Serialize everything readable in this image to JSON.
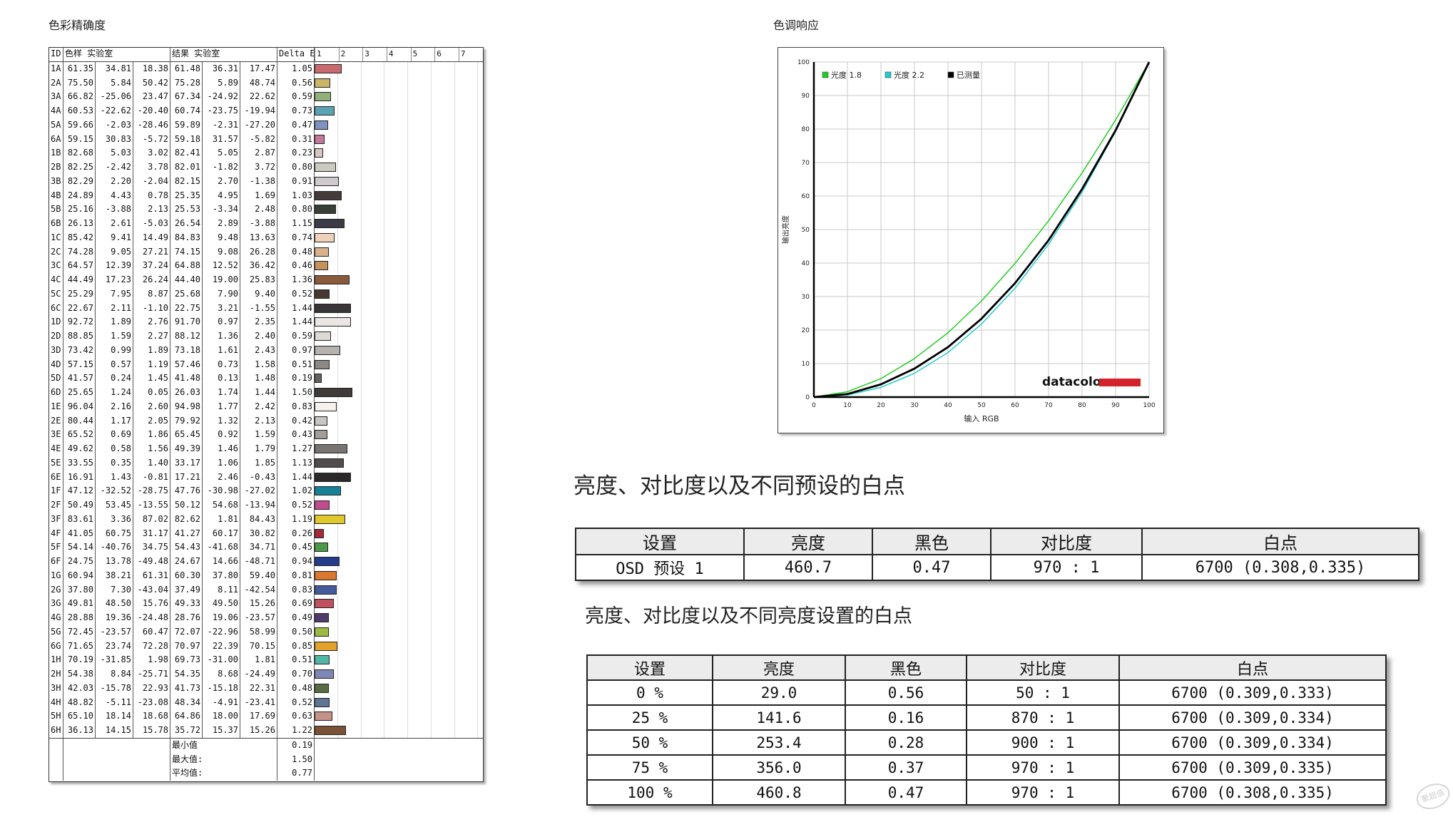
{
  "headings": {
    "color_accuracy": "色彩精确度",
    "tone_response": "色调响应"
  },
  "color_accuracy": {
    "columns": {
      "id": "ID",
      "sample": "色样 实验室",
      "result": "结果 实验室",
      "delta": "Delta E",
      "ruler": [
        "1",
        "2",
        "3",
        "4",
        "5",
        "6",
        "7"
      ]
    },
    "rows": [
      {
        "id": "1A",
        "sample": [
          "61.35",
          "34.81",
          "18.38"
        ],
        "result": [
          "61.48",
          "36.31",
          "17.47"
        ],
        "delta": "1.05",
        "de": 1.05,
        "color": "#c96a6f"
      },
      {
        "id": "2A",
        "sample": [
          "75.50",
          "5.84",
          "50.42"
        ],
        "result": [
          "75.28",
          "5.89",
          "48.74"
        ],
        "delta": "0.56",
        "de": 0.56,
        "color": "#cdb568"
      },
      {
        "id": "3A",
        "sample": [
          "66.82",
          "-25.06",
          "23.47"
        ],
        "result": [
          "67.34",
          "-24.92",
          "22.62"
        ],
        "delta": "0.59",
        "de": 0.59,
        "color": "#90b07a"
      },
      {
        "id": "4A",
        "sample": [
          "60.53",
          "-22.62",
          "-20.40"
        ],
        "result": [
          "60.74",
          "-23.75",
          "-19.94"
        ],
        "delta": "0.73",
        "de": 0.73,
        "color": "#5aa3b3"
      },
      {
        "id": "5A",
        "sample": [
          "59.66",
          "-2.03",
          "-28.46"
        ],
        "result": [
          "59.89",
          "-2.31",
          "-27.20"
        ],
        "delta": "0.47",
        "de": 0.47,
        "color": "#7f92c1"
      },
      {
        "id": "6A",
        "sample": [
          "59.15",
          "30.83",
          "-5.72"
        ],
        "result": [
          "59.18",
          "31.57",
          "-5.82"
        ],
        "delta": "0.31",
        "de": 0.31,
        "color": "#c4799b"
      },
      {
        "id": "1B",
        "sample": [
          "82.68",
          "5.03",
          "3.02"
        ],
        "result": [
          "82.41",
          "5.05",
          "2.87"
        ],
        "delta": "0.23",
        "de": 0.23,
        "color": "#d9c6c2"
      },
      {
        "id": "2B",
        "sample": [
          "82.25",
          "-2.42",
          "3.78"
        ],
        "result": [
          "82.01",
          "-1.82",
          "3.72"
        ],
        "delta": "0.80",
        "de": 0.8,
        "color": "#cccbc1"
      },
      {
        "id": "3B",
        "sample": [
          "82.29",
          "2.20",
          "-2.04"
        ],
        "result": [
          "82.15",
          "2.70",
          "-1.38"
        ],
        "delta": "0.91",
        "de": 0.91,
        "color": "#d0cacf"
      },
      {
        "id": "4B",
        "sample": [
          "24.89",
          "4.43",
          "0.78"
        ],
        "result": [
          "25.35",
          "4.95",
          "1.69"
        ],
        "delta": "1.03",
        "de": 1.03,
        "color": "#443c3b"
      },
      {
        "id": "5B",
        "sample": [
          "25.16",
          "-3.88",
          "2.13"
        ],
        "result": [
          "25.53",
          "-3.34",
          "2.48"
        ],
        "delta": "0.80",
        "de": 0.8,
        "color": "#383f37"
      },
      {
        "id": "6B",
        "sample": [
          "26.13",
          "2.61",
          "-5.03"
        ],
        "result": [
          "26.54",
          "2.89",
          "-3.88"
        ],
        "delta": "1.15",
        "de": 1.15,
        "color": "#3c3c46"
      },
      {
        "id": "1C",
        "sample": [
          "85.42",
          "9.41",
          "14.49"
        ],
        "result": [
          "84.83",
          "9.48",
          "13.63"
        ],
        "delta": "0.74",
        "de": 0.74,
        "color": "#efd1bc"
      },
      {
        "id": "2C",
        "sample": [
          "74.28",
          "9.05",
          "27.21"
        ],
        "result": [
          "74.15",
          "9.08",
          "26.28"
        ],
        "delta": "0.48",
        "de": 0.48,
        "color": "#d9b28c"
      },
      {
        "id": "3C",
        "sample": [
          "64.57",
          "12.39",
          "37.24"
        ],
        "result": [
          "64.88",
          "12.52",
          "36.42"
        ],
        "delta": "0.46",
        "de": 0.46,
        "color": "#c3935b"
      },
      {
        "id": "4C",
        "sample": [
          "44.49",
          "17.23",
          "26.24"
        ],
        "result": [
          "44.40",
          "19.00",
          "25.83"
        ],
        "delta": "1.36",
        "de": 1.36,
        "color": "#8a5a3c"
      },
      {
        "id": "5C",
        "sample": [
          "25.29",
          "7.95",
          "8.87"
        ],
        "result": [
          "25.68",
          "7.90",
          "9.40"
        ],
        "delta": "0.52",
        "de": 0.52,
        "color": "#4a3730"
      },
      {
        "id": "6C",
        "sample": [
          "22.67",
          "2.11",
          "-1.10"
        ],
        "result": [
          "22.75",
          "3.21",
          "-1.55"
        ],
        "delta": "1.44",
        "de": 1.44,
        "color": "#383536"
      },
      {
        "id": "1D",
        "sample": [
          "92.72",
          "1.89",
          "2.76"
        ],
        "result": [
          "91.70",
          "0.97",
          "2.35"
        ],
        "delta": "1.44",
        "de": 1.44,
        "color": "#ebe6e3"
      },
      {
        "id": "2D",
        "sample": [
          "88.85",
          "1.59",
          "2.27"
        ],
        "result": [
          "88.12",
          "1.36",
          "2.40"
        ],
        "delta": "0.59",
        "de": 0.59,
        "color": "#ddd9d5"
      },
      {
        "id": "3D",
        "sample": [
          "73.42",
          "0.99",
          "1.89"
        ],
        "result": [
          "73.18",
          "1.61",
          "2.43"
        ],
        "delta": "0.97",
        "de": 0.97,
        "color": "#b7b2ae"
      },
      {
        "id": "4D",
        "sample": [
          "57.15",
          "0.57",
          "1.19"
        ],
        "result": [
          "57.46",
          "0.73",
          "1.58"
        ],
        "delta": "0.51",
        "de": 0.51,
        "color": "#8c8885"
      },
      {
        "id": "5D",
        "sample": [
          "41.57",
          "0.24",
          "1.45"
        ],
        "result": [
          "41.48",
          "0.13",
          "1.48"
        ],
        "delta": "0.19",
        "de": 0.19,
        "color": "#64615e"
      },
      {
        "id": "6D",
        "sample": [
          "25.65",
          "1.24",
          "0.05"
        ],
        "result": [
          "26.03",
          "1.74",
          "1.44"
        ],
        "delta": "1.50",
        "de": 1.5,
        "color": "#3e3b3a"
      },
      {
        "id": "1E",
        "sample": [
          "96.04",
          "2.16",
          "2.60"
        ],
        "result": [
          "94.98",
          "1.77",
          "2.42"
        ],
        "delta": "0.83",
        "de": 0.83,
        "color": "#f6f1ee"
      },
      {
        "id": "2E",
        "sample": [
          "80.44",
          "1.17",
          "2.05"
        ],
        "result": [
          "79.92",
          "1.32",
          "2.13"
        ],
        "delta": "0.42",
        "de": 0.42,
        "color": "#c9c5c1"
      },
      {
        "id": "3E",
        "sample": [
          "65.52",
          "0.69",
          "1.86"
        ],
        "result": [
          "65.45",
          "0.92",
          "1.59"
        ],
        "delta": "0.43",
        "de": 0.43,
        "color": "#a19d99"
      },
      {
        "id": "4E",
        "sample": [
          "49.62",
          "0.58",
          "1.56"
        ],
        "result": [
          "49.39",
          "1.46",
          "1.79"
        ],
        "delta": "1.27",
        "de": 1.27,
        "color": "#777472"
      },
      {
        "id": "5E",
        "sample": [
          "33.55",
          "0.35",
          "1.40"
        ],
        "result": [
          "33.17",
          "1.06",
          "1.85"
        ],
        "delta": "1.13",
        "de": 1.13,
        "color": "#504d4c"
      },
      {
        "id": "6E",
        "sample": [
          "16.91",
          "1.43",
          "-0.81"
        ],
        "result": [
          "17.21",
          "2.46",
          "-0.43"
        ],
        "delta": "1.44",
        "de": 1.44,
        "color": "#2a2829"
      },
      {
        "id": "1F",
        "sample": [
          "47.12",
          "-32.52",
          "-28.75"
        ],
        "result": [
          "47.76",
          "-30.98",
          "-27.02"
        ],
        "delta": "1.02",
        "de": 1.02,
        "color": "#168298"
      },
      {
        "id": "2F",
        "sample": [
          "50.49",
          "53.45",
          "-13.55"
        ],
        "result": [
          "50.12",
          "54.68",
          "-13.94"
        ],
        "delta": "0.52",
        "de": 0.52,
        "color": "#c24b8e"
      },
      {
        "id": "3F",
        "sample": [
          "83.61",
          "3.36",
          "87.02"
        ],
        "result": [
          "82.62",
          "1.81",
          "84.43"
        ],
        "delta": "1.19",
        "de": 1.19,
        "color": "#e1c92b"
      },
      {
        "id": "4F",
        "sample": [
          "41.05",
          "60.75",
          "31.17"
        ],
        "result": [
          "41.27",
          "60.17",
          "30.82"
        ],
        "delta": "0.26",
        "de": 0.26,
        "color": "#a5283c"
      },
      {
        "id": "5F",
        "sample": [
          "54.14",
          "-40.76",
          "34.75"
        ],
        "result": [
          "54.43",
          "-41.68",
          "34.71"
        ],
        "delta": "0.45",
        "de": 0.45,
        "color": "#4c9a48"
      },
      {
        "id": "6F",
        "sample": [
          "24.75",
          "13.78",
          "-49.48"
        ],
        "result": [
          "24.67",
          "14.66",
          "-48.71"
        ],
        "delta": "0.94",
        "de": 0.94,
        "color": "#243c8a"
      },
      {
        "id": "1G",
        "sample": [
          "60.94",
          "38.21",
          "61.31"
        ],
        "result": [
          "60.30",
          "37.80",
          "59.40"
        ],
        "delta": "0.81",
        "de": 0.81,
        "color": "#d9782e"
      },
      {
        "id": "2G",
        "sample": [
          "37.80",
          "7.30",
          "-43.04"
        ],
        "result": [
          "37.49",
          "8.11",
          "-42.54"
        ],
        "delta": "0.83",
        "de": 0.83,
        "color": "#435a9c"
      },
      {
        "id": "3G",
        "sample": [
          "49.81",
          "48.50",
          "15.76"
        ],
        "result": [
          "49.33",
          "49.50",
          "15.26"
        ],
        "delta": "0.69",
        "de": 0.69,
        "color": "#c25160"
      },
      {
        "id": "4G",
        "sample": [
          "28.88",
          "19.36",
          "-24.48"
        ],
        "result": [
          "28.76",
          "19.06",
          "-23.57"
        ],
        "delta": "0.49",
        "de": 0.49,
        "color": "#503c6a"
      },
      {
        "id": "5G",
        "sample": [
          "72.45",
          "-23.57",
          "60.47"
        ],
        "result": [
          "72.07",
          "-22.96",
          "58.99"
        ],
        "delta": "0.50",
        "de": 0.5,
        "color": "#9cba43"
      },
      {
        "id": "6G",
        "sample": [
          "71.65",
          "23.74",
          "72.28"
        ],
        "result": [
          "70.97",
          "22.39",
          "70.15"
        ],
        "delta": "0.85",
        "de": 0.85,
        "color": "#e2a22c"
      },
      {
        "id": "1H",
        "sample": [
          "70.19",
          "-31.85",
          "1.98"
        ],
        "result": [
          "69.73",
          "-31.00",
          "1.81"
        ],
        "delta": "0.51",
        "de": 0.51,
        "color": "#50b7a4"
      },
      {
        "id": "2H",
        "sample": [
          "54.38",
          "8.84",
          "-25.71"
        ],
        "result": [
          "54.35",
          "8.68",
          "-24.49"
        ],
        "delta": "0.70",
        "de": 0.7,
        "color": "#7f87b7"
      },
      {
        "id": "3H",
        "sample": [
          "42.03",
          "-15.78",
          "22.93"
        ],
        "result": [
          "41.73",
          "-15.18",
          "22.31"
        ],
        "delta": "0.48",
        "de": 0.48,
        "color": "#596c43"
      },
      {
        "id": "4H",
        "sample": [
          "48.82",
          "-5.11",
          "-23.08"
        ],
        "result": [
          "48.34",
          "-4.91",
          "-23.41"
        ],
        "delta": "0.52",
        "de": 0.52,
        "color": "#5e7596"
      },
      {
        "id": "5H",
        "sample": [
          "65.10",
          "18.14",
          "18.68"
        ],
        "result": [
          "64.86",
          "18.00",
          "17.69"
        ],
        "delta": "0.63",
        "de": 0.63,
        "color": "#c49286"
      },
      {
        "id": "6H",
        "sample": [
          "36.13",
          "14.15",
          "15.78"
        ],
        "result": [
          "35.72",
          "15.37",
          "15.26"
        ],
        "delta": "1.22",
        "de": 1.22,
        "color": "#7a5238"
      }
    ],
    "summary": [
      {
        "label": "最小值",
        "value": "0.19"
      },
      {
        "label": "最大值:",
        "value": "1.50"
      },
      {
        "label": "平均值:",
        "value": "0.77"
      }
    ]
  },
  "chart_data": {
    "type": "line",
    "title": "色调响应",
    "xlabel": "输入 RGB",
    "ylabel": "输出亮度",
    "xlim": [
      0,
      100
    ],
    "ylim": [
      0,
      100
    ],
    "grid": true,
    "legend_position": "top-left",
    "x": [
      0,
      10,
      20,
      30,
      40,
      50,
      60,
      70,
      80,
      90,
      100
    ],
    "series": [
      {
        "name": "光度 1.8",
        "color": "#22cc22",
        "values": [
          0,
          1.6,
          5.5,
          11.5,
          19.2,
          28.7,
          39.9,
          52.6,
          66.9,
          82.7,
          100
        ]
      },
      {
        "name": "光度 2.2",
        "color": "#22cccc",
        "values": [
          0,
          0.6,
          2.9,
          7.1,
          13.3,
          21.8,
          32.5,
          45.6,
          61.2,
          79.3,
          100
        ]
      },
      {
        "name": "已测量",
        "color": "#000000",
        "values": [
          0,
          0.9,
          3.8,
          8.5,
          14.9,
          23.4,
          34.0,
          46.8,
          62.1,
          79.6,
          100
        ]
      }
    ],
    "brand": "datacolor",
    "brand_color": "#d2232a"
  },
  "table1": {
    "title": "亮度、对比度以及不同预设的白点",
    "headers": [
      "设置",
      "亮度",
      "黑色",
      "对比度",
      "白点"
    ],
    "rows": [
      [
        "OSD 预设 1",
        "460.7",
        "0.47",
        "970 : 1",
        "6700 (0.308,0.335)"
      ]
    ]
  },
  "table2": {
    "title": "亮度、对比度以及不同亮度设置的白点",
    "headers": [
      "设置",
      "亮度",
      "黑色",
      "对比度",
      "白点"
    ],
    "rows": [
      [
        "0 %",
        "29.0",
        "0.56",
        "50 : 1",
        "6700 (0.309,0.333)"
      ],
      [
        "25 %",
        "141.6",
        "0.16",
        "870 : 1",
        "6700 (0.309,0.334)"
      ],
      [
        "50 %",
        "253.4",
        "0.28",
        "900 : 1",
        "6700 (0.309,0.334)"
      ],
      [
        "75 %",
        "356.0",
        "0.37",
        "970 : 1",
        "6700 (0.309,0.335)"
      ],
      [
        "100 %",
        "460.8",
        "0.47",
        "970 : 1",
        "6700 (0.308,0.335)"
      ]
    ]
  },
  "watermark": "聚超值"
}
